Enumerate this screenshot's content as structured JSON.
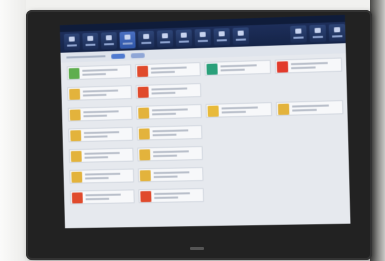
{
  "toolbar": {
    "buttons": [
      {
        "active": false
      },
      {
        "active": false
      },
      {
        "active": false
      },
      {
        "active": true
      },
      {
        "active": false
      },
      {
        "active": false
      },
      {
        "active": false
      },
      {
        "active": false
      },
      {
        "active": false
      },
      {
        "active": false
      },
      {
        "active": false
      },
      {
        "active": false
      },
      {
        "active": false
      }
    ]
  },
  "subbar": {
    "pill_colors": [
      "#4f7ad0",
      "#8fa6d6"
    ]
  },
  "tiles": [
    {
      "icon_color": "#5fae4f"
    },
    {
      "icon_color": "#e04a2c"
    },
    {
      "icon_color": "#2aa07a"
    },
    {
      "icon_color": "#e23b2c"
    },
    {
      "icon_color": "#e3b33c"
    },
    {
      "icon_color": "#e04a2c"
    },
    null,
    null,
    {
      "icon_color": "#e3b33c"
    },
    {
      "icon_color": "#e3b33c"
    },
    {
      "icon_color": "#e8ba3a"
    },
    {
      "icon_color": "#e3b33c"
    },
    {
      "icon_color": "#e3b33c"
    },
    {
      "icon_color": "#e3b33c"
    },
    null,
    null,
    {
      "icon_color": "#e3b33c"
    },
    {
      "icon_color": "#e3b33c"
    },
    null,
    null,
    {
      "icon_color": "#e3b33c"
    },
    {
      "icon_color": "#e3b33c"
    },
    null,
    null,
    {
      "icon_color": "#e04a2c"
    },
    {
      "icon_color": "#e04a2c"
    },
    null,
    null
  ],
  "colors": {
    "toolbar": "#152448",
    "screen_background": "#e6e9ee",
    "bezel": "#222222"
  }
}
